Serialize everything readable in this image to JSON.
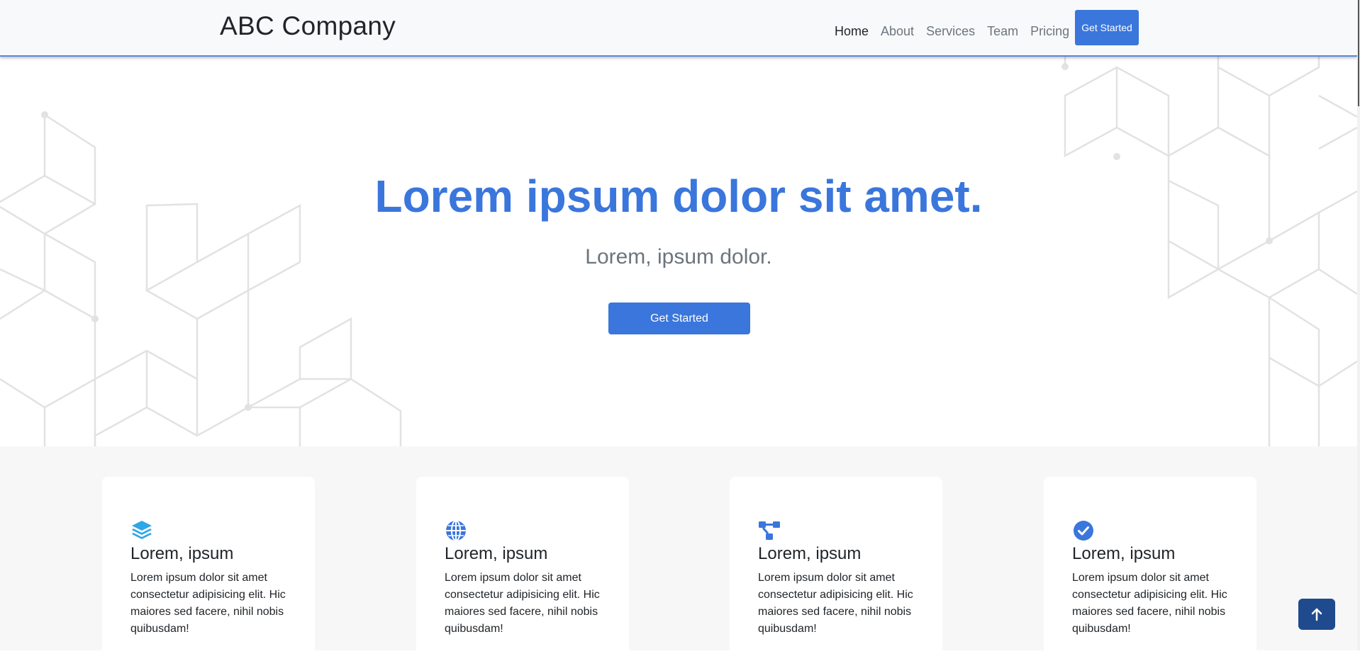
{
  "navbar": {
    "brand": "ABC Company",
    "links": [
      {
        "label": "Home"
      },
      {
        "label": "About"
      },
      {
        "label": "Services"
      },
      {
        "label": "Team"
      },
      {
        "label": "Pricing"
      }
    ],
    "cta_label": "Get Started"
  },
  "hero": {
    "title": "Lorem ipsum dolor sit amet.",
    "subtitle": "Lorem, ipsum dolor.",
    "cta_label": "Get Started"
  },
  "features": [
    {
      "icon": "layers-icon",
      "title": "Lorem, ipsum",
      "text": "Lorem ipsum dolor sit amet consectetur adipisicing elit. Hic maiores sed facere, nihil nobis quibusdam!"
    },
    {
      "icon": "globe-icon",
      "title": "Lorem, ipsum",
      "text": "Lorem ipsum dolor sit amet consectetur adipisicing elit. Hic maiores sed facere, nihil nobis quibusdam!"
    },
    {
      "icon": "sitemap-icon",
      "title": "Lorem, ipsum",
      "text": "Lorem ipsum dolor sit amet consectetur adipisicing elit. Hic maiores sed facere, nihil nobis quibusdam!"
    },
    {
      "icon": "check-circle-icon",
      "title": "Lorem, ipsum",
      "text": "Lorem ipsum dolor sit amet consectetur adipisicing elit. Hic maiores sed facere, nihil nobis quibusdam!"
    }
  ],
  "back_to_top_icon": "arrow-up-icon",
  "colors": {
    "primary": "#3a76dc",
    "icon_light_blue": "#2fa6e8",
    "back_to_top": "#1f4a8e",
    "navbar_border": "#5b86e5",
    "muted_text": "#6c757d",
    "features_bg": "#f7f7f7"
  }
}
